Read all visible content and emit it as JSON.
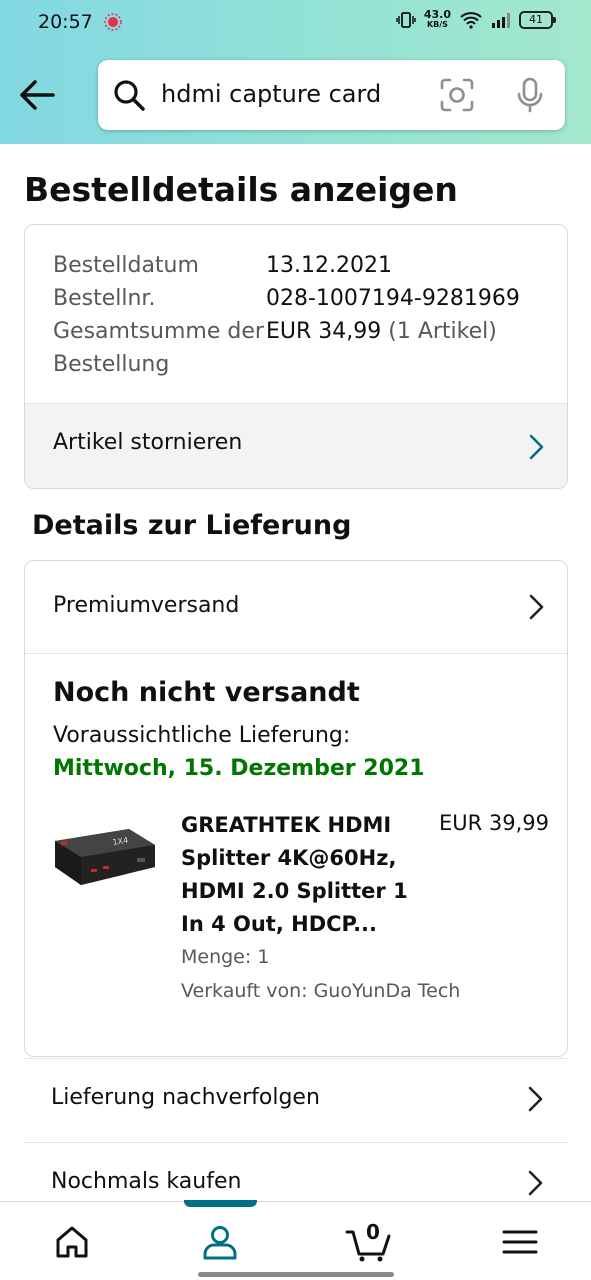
{
  "status_bar": {
    "time": "20:57",
    "net_speed": "43.0",
    "net_unit": "KB/S",
    "battery": "41"
  },
  "search": {
    "query": "hdmi capture card"
  },
  "page": {
    "title": "Bestelldetails anzeigen"
  },
  "order_summary": {
    "rows": [
      {
        "label": "Bestelldatum",
        "value": "13.12.2021",
        "extra": ""
      },
      {
        "label": "Bestellnr.",
        "value": "028-1007194-9281969",
        "extra": ""
      },
      {
        "label": "Gesamtsumme der Bestellung",
        "value": "EUR 34,99",
        "extra": "(1 Artikel)"
      }
    ],
    "cancel_label": "Artikel stornieren"
  },
  "delivery": {
    "section_title": "Details zur Lieferung",
    "shipping_method": "Premiumversand",
    "status": "Noch nicht versandt",
    "eta_label": "Voraussichtliche Lieferung:",
    "eta_date": "Mittwoch, 15. Dezember 2021",
    "item": {
      "name": "GREATHTEK HDMI Splitter 4K@60Hz, HDMI 2.0 Splitter 1 In 4 Out, HDCP...",
      "price": "EUR 39,99",
      "quantity": "Menge: 1",
      "seller": "Verkauft von: GuoYunDa Tech"
    }
  },
  "actions": {
    "track": "Lieferung nachverfolgen",
    "buy_again": "Nochmals kaufen"
  },
  "bottom_nav": {
    "cart_count": "0",
    "active_tab": "account",
    "accent_color": "#007185"
  }
}
